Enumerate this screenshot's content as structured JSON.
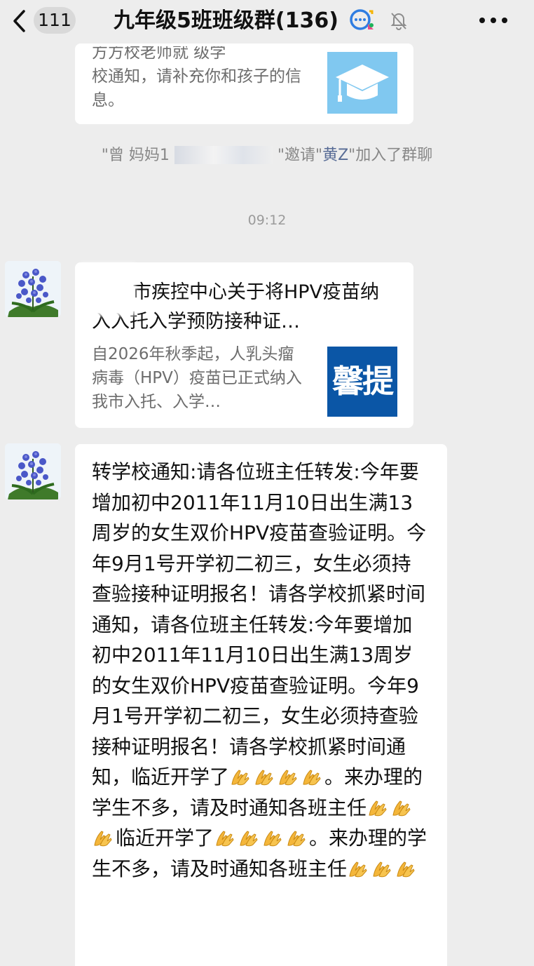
{
  "header": {
    "unread_count": "111",
    "title": "九年级5班班级群(136)"
  },
  "card1": {
    "partial_line": "方方校老师就  级学",
    "desc": "校通知，请补充你和孩子的信息。",
    "thumb_icon": "graduation-cap-icon"
  },
  "system_message": {
    "part1": "\"曾  妈妈1",
    "part2": "\"邀请\"",
    "invitee": "黄Z",
    "part3": "\"加入了群聊"
  },
  "timestamp": "09:12",
  "card2": {
    "title": "市疾控中心关于将HPV疫苗纳入入托入学预防接种证…",
    "desc": "自2026年秋季起，人乳头瘤病毒（HPV）疫苗已正式纳入我市入托、入学…",
    "thumb_text": "馨提"
  },
  "message": {
    "p1": "转学校通知:请各位班主任转发:今年要增加初中2011年11月10日出生满13周岁的女生双价HPV疫苗查验证明。今年9月1号开学初二初三，女生必须持查验接种证明报名！请各学校抓紧时间通知，请各位班主任转发:今年要增加初中2011年11月10日出生满13周岁的女生双价HPV疫苗查验证明。今年9月1号开学初二初三，女生必须持查验接种证明报名！请各学校抓紧时间通知，临近开学了",
    "p2": "。来办理的学生不多，请及时通知各班主任",
    "p3": "临近开学了",
    "p4": "。来办理的学生不多，请及时通知各班主任",
    "emoji_icon": "folded-hands-icon"
  },
  "colors": {
    "background": "#ededed",
    "bubble": "#ffffff",
    "link": "#576b95",
    "thumb_blue": "#0b56a6",
    "thumb_light": "#80c8f0"
  }
}
